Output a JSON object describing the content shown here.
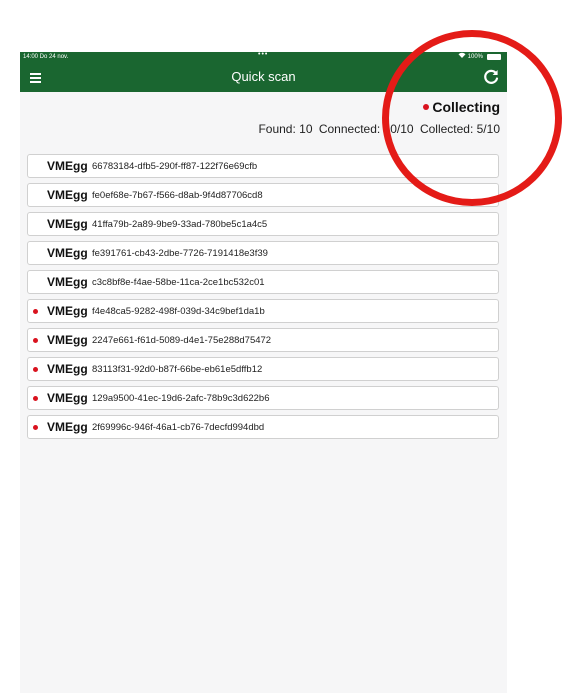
{
  "status_bar": {
    "time_date": "14:00  Do 24 nov.",
    "center_dots": "•••",
    "battery_text": "100%",
    "wifi_icon": "wifi-icon",
    "battery_icon": "battery-icon"
  },
  "nav": {
    "title": "Quick scan",
    "menu_icon": "hamburger-menu-icon",
    "refresh_icon": "refresh-icon",
    "bar_color": "#1a6630"
  },
  "scan_status": {
    "label": "Collecting",
    "indicator_color": "#d9121e"
  },
  "counts": {
    "found": "Found: 10",
    "connected": "Connected: 10/10",
    "collected": "Collected: 5/10"
  },
  "devices": [
    {
      "name": "VMEgg",
      "id": "66783184-dfb5-290f-ff87-122f76e69cfb",
      "collecting": false
    },
    {
      "name": "VMEgg",
      "id": "fe0ef68e-7b67-f566-d8ab-9f4d87706cd8",
      "collecting": false
    },
    {
      "name": "VMEgg",
      "id": "41ffa79b-2a89-9be9-33ad-780be5c1a4c5",
      "collecting": false
    },
    {
      "name": "VMEgg",
      "id": "fe391761-cb43-2dbe-7726-7191418e3f39",
      "collecting": false
    },
    {
      "name": "VMEgg",
      "id": "c3c8bf8e-f4ae-58be-11ca-2ce1bc532c01",
      "collecting": false
    },
    {
      "name": "VMEgg",
      "id": "f4e48ca5-9282-498f-039d-34c9bef1da1b",
      "collecting": true
    },
    {
      "name": "VMEgg",
      "id": "2247e661-f61d-5089-d4e1-75e288d75472",
      "collecting": true
    },
    {
      "name": "VMEgg",
      "id": "83113f31-92d0-b87f-66be-eb61e5dffb12",
      "collecting": true
    },
    {
      "name": "VMEgg",
      "id": "129a9500-41ec-19d6-2afc-78b9c3d622b6",
      "collecting": true
    },
    {
      "name": "VMEgg",
      "id": "2f69996c-946f-46a1-cb76-7decfd994dbd",
      "collecting": true
    }
  ],
  "annotation": {
    "shape": "circle",
    "color": "#e41b17"
  }
}
